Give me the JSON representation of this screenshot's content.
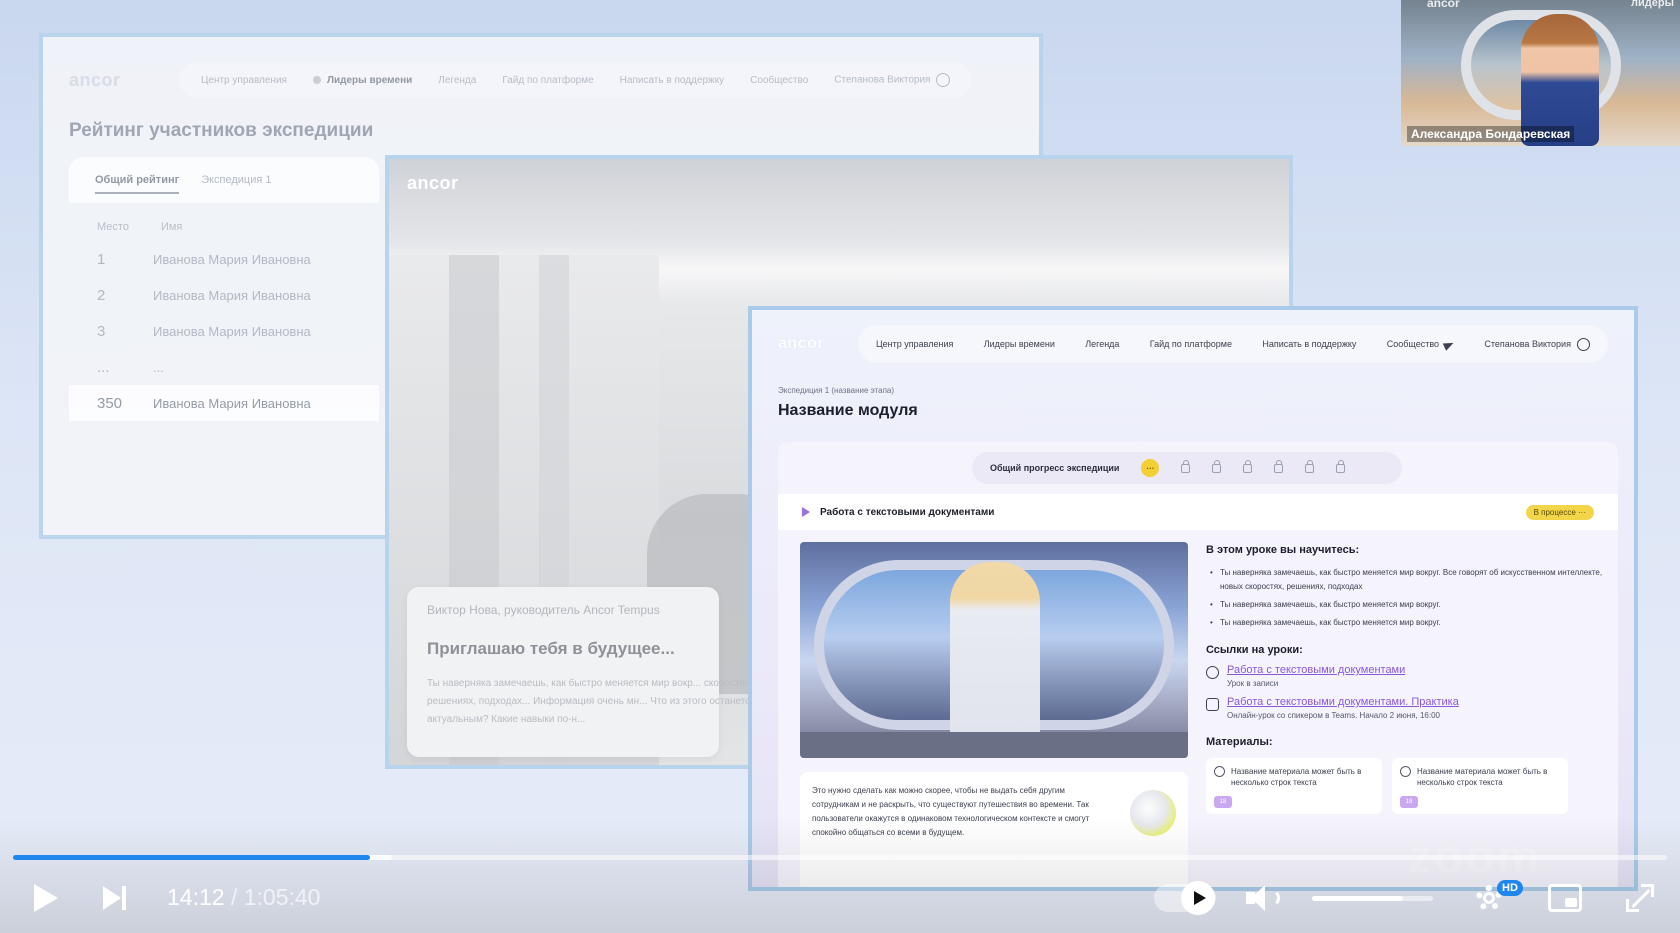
{
  "slide_rating": {
    "logo": "ancor",
    "nav": [
      "Центр управления",
      "Лидеры времени",
      "Легенда",
      "Гайд по платформе",
      "Написать в поддержку",
      "Сообщество",
      "Степанова Виктория"
    ],
    "title": "Рейтинг участников экспедиции",
    "tabs": [
      "Общий рейтинг",
      "Экспедиция 1"
    ],
    "columns": [
      "Место",
      "Имя"
    ],
    "rows": [
      {
        "place": "1",
        "name": "Иванова Мария Ивановна"
      },
      {
        "place": "2",
        "name": "Иванова Мария Ивановна"
      },
      {
        "place": "3",
        "name": "Иванова Мария Ивановна"
      },
      {
        "place": "...",
        "name": "..."
      },
      {
        "place": "350",
        "name": "Иванова Мария Ивановна"
      }
    ]
  },
  "slide_promo": {
    "logo": "ancor",
    "author": "Виктор Нова, руководитель Ancor Tempus",
    "headline": "Приглашаю тебя в будущее...",
    "body": "Ты наверняка замечаешь, как быстро меняется мир вокр... скоростях, решениях, подходах... Информация очень мн... Что из этого останется актуальным? Какие навыки по-н..."
  },
  "slide_module": {
    "logo": "ancor",
    "nav": [
      "Центр управления",
      "Лидеры времени",
      "Легенда",
      "Гайд по платформе",
      "Написать в поддержку",
      "Сообщество",
      "Степанова Виктория"
    ],
    "breadcrumb": "Экспедиция 1 (название этапа)",
    "title": "Название модуля",
    "progress_label": "Общий прогресс экспедиции",
    "progress_current": "···",
    "lesson_title": "Работа с текстовыми документами",
    "lesson_status": "В процессе ···",
    "learn_title": "В этом уроке вы научитесь:",
    "learn_items": [
      "Ты наверняка замечаешь, как быстро меняется мир вокруг. Все говорят об искусственном интеллекте, новых скоростях, решениях, подходах",
      "Ты наверняка замечаешь, как быстро меняется мир вокруг.",
      "Ты наверняка замечаешь, как быстро меняется мир вокруг."
    ],
    "links_title": "Ссылки на уроки:",
    "links": [
      {
        "title": "Работа с текстовыми документами",
        "sub": "Урок в записи"
      },
      {
        "title": "Работа с текстовыми документами. Практика",
        "sub": "Онлайн-урок со спикером в Teams. Начало 2 июня, 16:00"
      }
    ],
    "materials_title": "Материалы:",
    "materials": [
      {
        "title": "Название материала может быть в несколько строк текста",
        "tag": "18"
      },
      {
        "title": "Название материала может быть в несколько строк текста",
        "tag": "18"
      }
    ],
    "note": "Это нужно сделать как можно скорее, чтобы не выдать себя другим сотрудникам и не раскрыть, что существуют путешествия во времени. Так пользователи окажутся в одинаковом технологическом контексте и смогут спокойно общаться со всеми в будущем.",
    "watermark": "zoom"
  },
  "participant": {
    "name": "Александра Бондаревская",
    "top_left": "ancor",
    "top_right": "лидеры"
  },
  "player": {
    "current_time": "14:12",
    "separator": " / ",
    "duration": "1:05:40",
    "progress_fraction": 0.2157,
    "buffered_fraction": 0.229,
    "volume_fraction": 0.75,
    "quality_badge": "HD",
    "accent_color": "#1f86ee",
    "icons": [
      "play-icon",
      "next-icon",
      "autoplay-toggle",
      "volume-icon",
      "settings-gear-icon",
      "pip-icon",
      "fullscreen-icon"
    ]
  }
}
